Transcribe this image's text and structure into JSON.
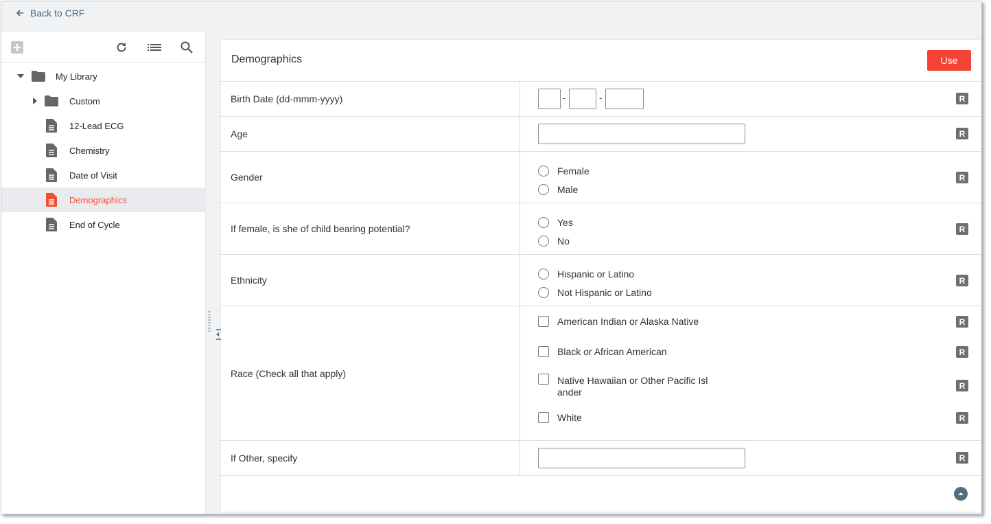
{
  "topbar": {
    "back_label": "Back to CRF",
    "back_icon": "arrow-left-icon"
  },
  "toolbar": {
    "icons": [
      "add-icon",
      "refresh-icon",
      "list-icon",
      "search-icon"
    ]
  },
  "tree": {
    "root": "My Library",
    "items": [
      {
        "label": "Custom",
        "type": "folder"
      },
      {
        "label": "12-Lead ECG",
        "type": "form"
      },
      {
        "label": "Chemistry",
        "type": "form"
      },
      {
        "label": "Date of Visit",
        "type": "form"
      },
      {
        "label": "Demographics",
        "type": "form",
        "selected": true
      },
      {
        "label": "End of Cycle",
        "type": "form"
      }
    ]
  },
  "form": {
    "title": "Demographics",
    "use_label": "Use",
    "badge": "R",
    "rows": [
      {
        "label": "Birth Date (dd-mmm-yyyy)",
        "date_sep": "-"
      },
      {
        "label": "Age"
      },
      {
        "label": "Gender",
        "options": [
          "Female",
          "Male"
        ]
      },
      {
        "label": "If female, is she of child bearing potential?",
        "options": [
          "Yes",
          "No"
        ]
      },
      {
        "label": "Ethnicity",
        "options": [
          "Hispanic or Latino",
          "Not Hispanic or Latino"
        ]
      },
      {
        "label": "Race (Check all that apply)",
        "options": [
          "American Indian or Alaska Native",
          "Black or African American",
          "Native Hawaiian or Other Pacific Isl ander",
          "White"
        ]
      },
      {
        "label": "If Other, specify"
      }
    ]
  },
  "colors": {
    "accent": "#f0502f",
    "button": "#f44336",
    "link": "#4a6a80",
    "badge": "#6f6f6f"
  }
}
